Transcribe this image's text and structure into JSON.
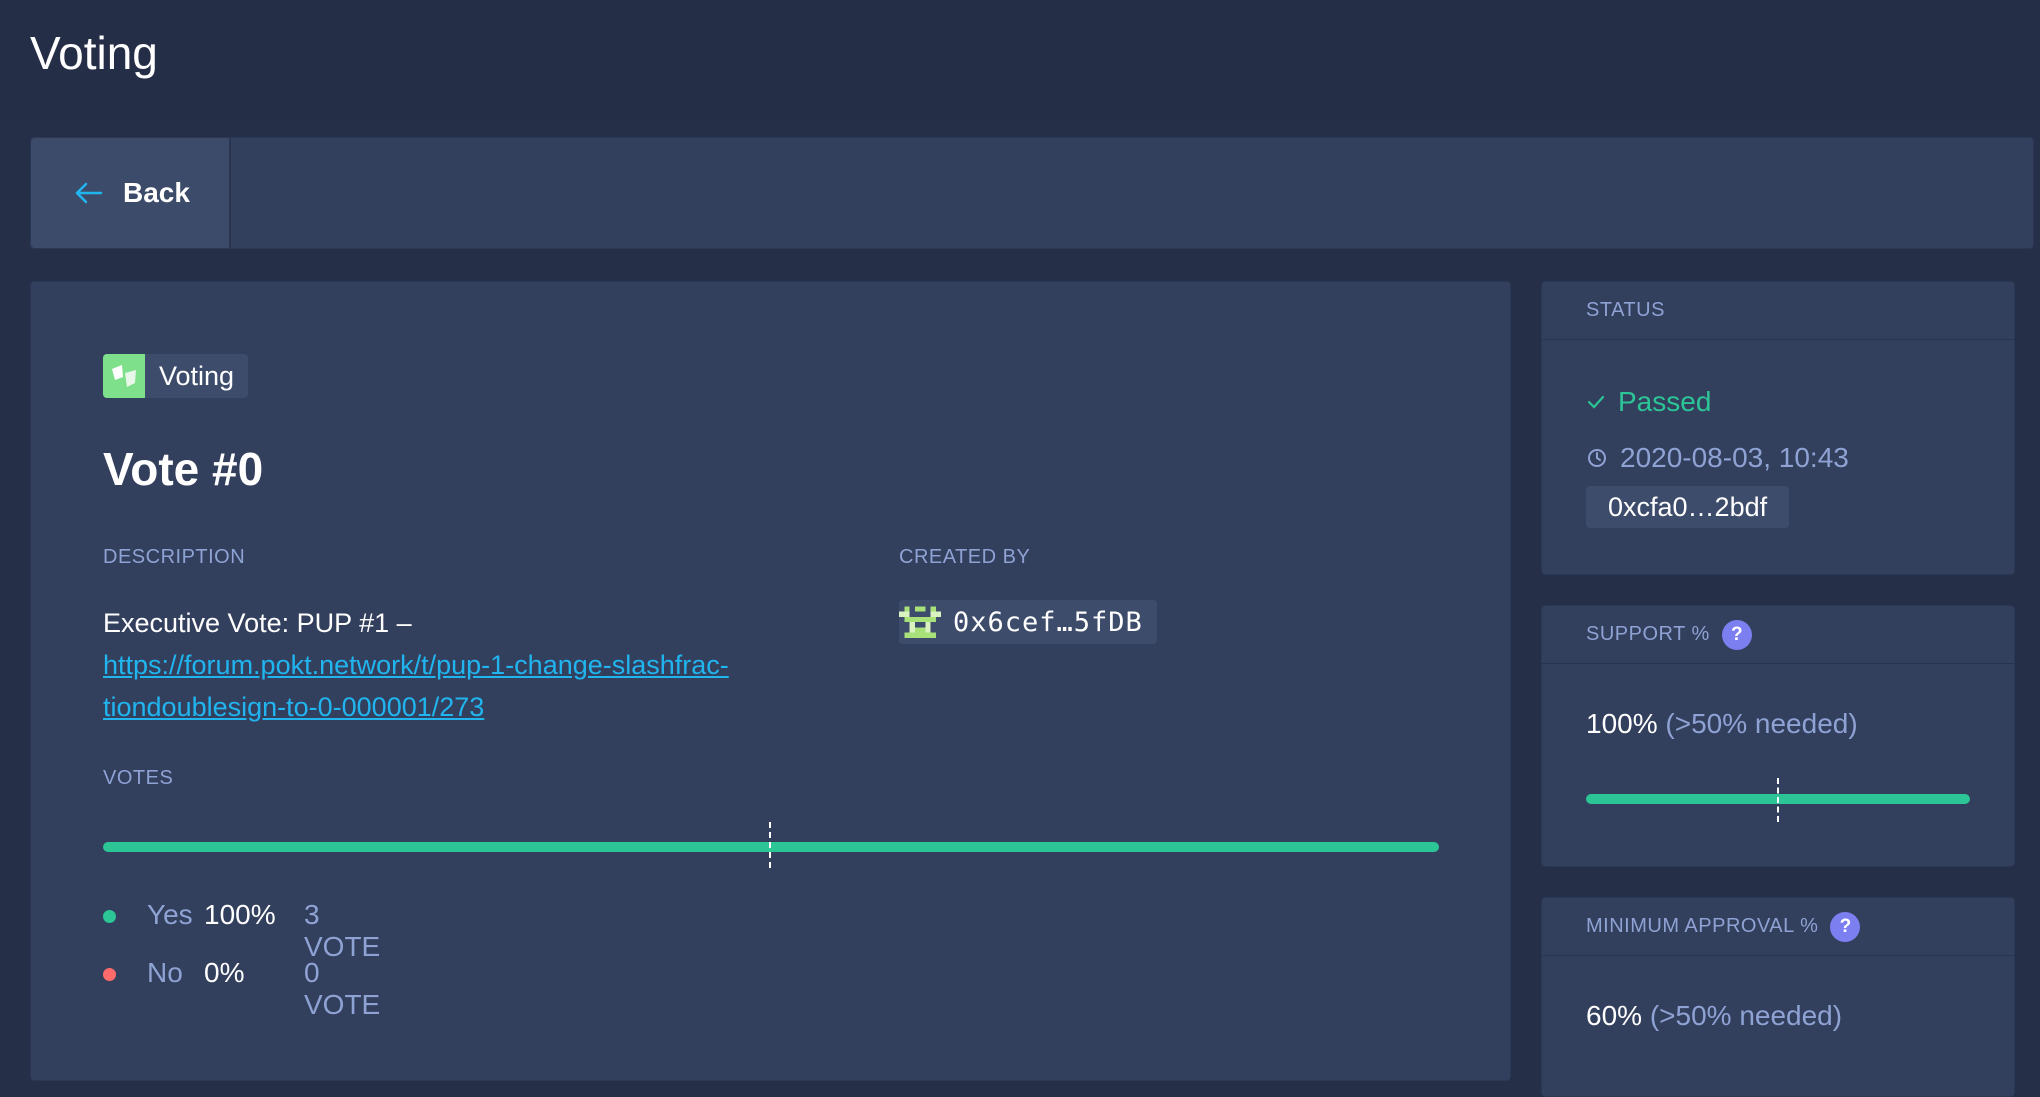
{
  "header": {
    "title": "Voting"
  },
  "toolbar": {
    "back_label": "Back"
  },
  "vote": {
    "app_name": "Voting",
    "title": "Vote #0",
    "description_label": "DESCRIPTION",
    "description_text": "Executive Vote: PUP #1 –",
    "description_link": "https://forum.pokt.network/t/pup-1-change-slashfrac-tiondoublesign-to-0-000001/273",
    "created_by_label": "CREATED BY",
    "creator_address": "0x6cef…5fDB",
    "votes_label": "VOTES",
    "yes_share": 1.0,
    "options": [
      {
        "label": "Yes",
        "percent": "100%",
        "count": "3 VOTE",
        "color": "#2cc596"
      },
      {
        "label": "No",
        "percent": "0%",
        "count": "0 VOTE",
        "color": "#ff6a6a"
      }
    ]
  },
  "status": {
    "title": "STATUS",
    "result": "Passed",
    "datetime": "2020-08-03, 10:43",
    "tx_hash": "0xcfa0…2bdf"
  },
  "support": {
    "title": "SUPPORT %",
    "help": "?",
    "value": "100%",
    "needed": "(>50% needed)",
    "fill": 1.0,
    "threshold": 0.5
  },
  "min_approval": {
    "title": "MINIMUM APPROVAL %",
    "help": "?",
    "value": "60%",
    "needed": "(>50% needed)"
  },
  "colors": {
    "accent_green": "#2cc596",
    "accent_blue": "#21b5f0",
    "help_purple": "#7b7ff0",
    "no_red": "#ff6a6a"
  }
}
